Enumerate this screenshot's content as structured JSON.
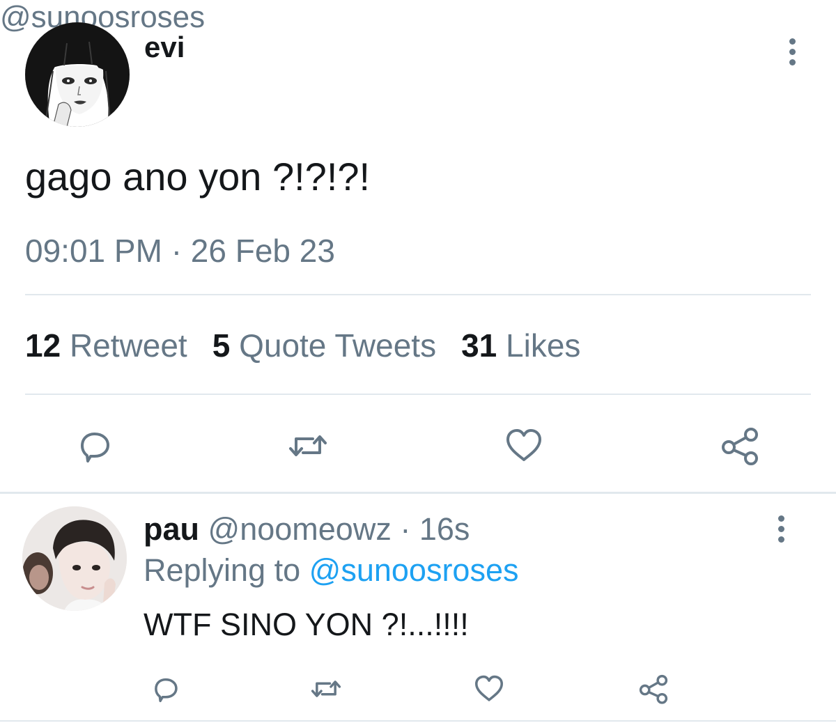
{
  "tweet": {
    "author": {
      "display_name": "evi",
      "handle": "@sunoosroses",
      "avatar_icon": "manga-girl-avatar"
    },
    "text": "gago ano yon ?!?!?!",
    "timestamp": {
      "time": "09:01 PM",
      "separator": "·",
      "date": "26 Feb 23"
    },
    "stats": {
      "retweets": {
        "count": "12",
        "label": "Retweet"
      },
      "quotes": {
        "count": "5",
        "label": "Quote Tweets"
      },
      "likes": {
        "count": "31",
        "label": "Likes"
      }
    },
    "actions": [
      "reply-icon",
      "retweet-icon",
      "like-icon",
      "share-icon"
    ],
    "more_icon": "more-vertical-icon"
  },
  "reply": {
    "author": {
      "display_name": "pau",
      "handle": "@noomeowz",
      "avatar_icon": "person-photo-avatar"
    },
    "separator": "·",
    "time_ago": "16s",
    "replying_to_label": "Replying to",
    "replying_to_handle": "@sunoosroses",
    "text": "WTF SINO YON ?!...!!!!",
    "actions": [
      "reply-icon",
      "retweet-icon",
      "like-icon",
      "share-icon"
    ],
    "more_icon": "more-vertical-icon"
  },
  "colors": {
    "primary_text": "#14171a",
    "secondary_text": "#657786",
    "link": "#1da1f2",
    "divider": "#e1e8ed",
    "background": "#ffffff"
  }
}
